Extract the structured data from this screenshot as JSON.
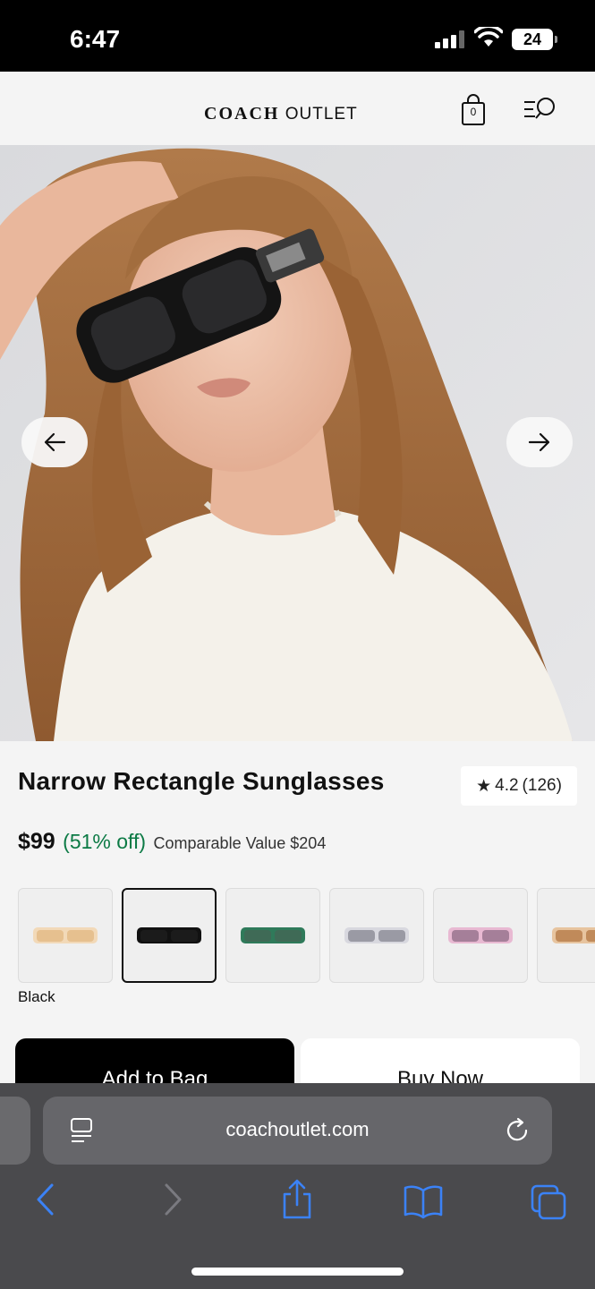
{
  "status_bar": {
    "time": "6:47",
    "battery": "24"
  },
  "header": {
    "logo_brand": "COACH",
    "logo_suffix": "OUTLET",
    "bag_count": "0"
  },
  "product": {
    "title": "Narrow Rectangle Sunglasses",
    "rating": "4.2",
    "review_count": "(126)",
    "price": "$99",
    "discount": "(51% off)",
    "comparable": "Comparable Value $204",
    "selected_color": "Black",
    "swatches": [
      {
        "color": "#e6c08f",
        "frame": "#f2d9b8",
        "selected": false
      },
      {
        "color": "#1b1b1b",
        "frame": "#111111",
        "selected": true
      },
      {
        "color": "#3f6a56",
        "frame": "#2f7a5a",
        "selected": false
      },
      {
        "color": "#9a9aa4",
        "frame": "#d8d8df",
        "selected": false
      },
      {
        "color": "#a57f99",
        "frame": "#e8b9d2",
        "selected": false
      },
      {
        "color": "#c08a5a",
        "frame": "#e7c49f",
        "selected": false
      }
    ]
  },
  "actions": {
    "add_to_bag": "Add to Bag",
    "buy_now": "Buy Now"
  },
  "browser": {
    "url": "coachoutlet.com"
  },
  "colors": {
    "accent_green": "#0c7a45",
    "browser_blue": "#3b82f6"
  }
}
